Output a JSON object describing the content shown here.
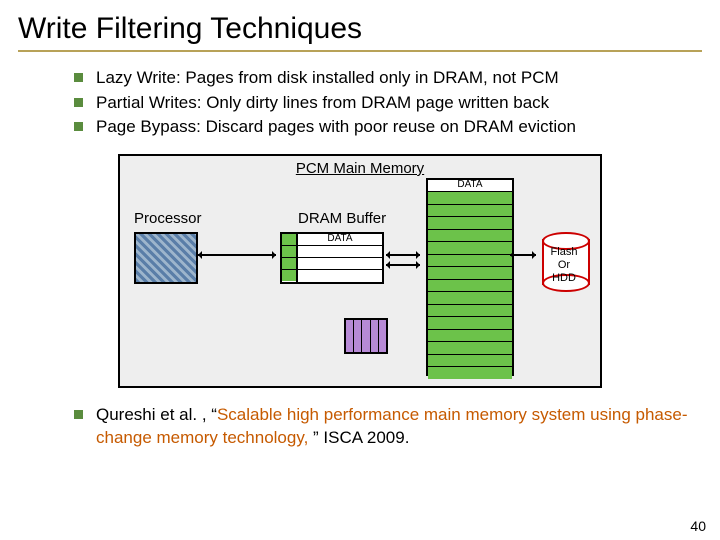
{
  "title": "Write Filtering Techniques",
  "bullets": [
    "Lazy Write: Pages from disk installed only in DRAM, not PCM",
    "Partial Writes:  Only dirty lines from DRAM page written back",
    "Page Bypass: Discard pages with poor reuse on DRAM eviction"
  ],
  "diagram": {
    "pcm_label": "PCM Main Memory",
    "processor_label": "Processor",
    "dram_label": "DRAM Buffer",
    "data_label": "DATA",
    "disk_line1": "Flash",
    "disk_line2": "Or",
    "disk_line3": "HDD"
  },
  "citation": {
    "prefix": "Qureshi et al. , “",
    "title": "Scalable high performance main memory system using phase-change memory technology,",
    "suffix": " ” ISCA 2009."
  },
  "page_number": "40"
}
